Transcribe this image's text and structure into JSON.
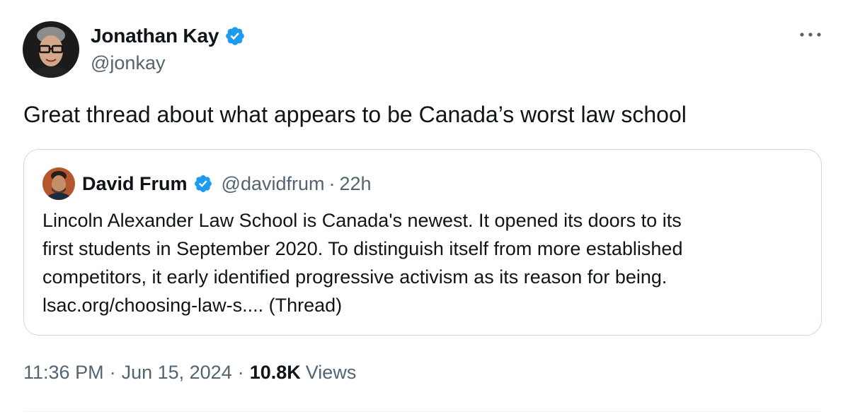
{
  "author": {
    "name": "Jonathan Kay",
    "handle": "@jonkay",
    "verified": true
  },
  "tweet": {
    "text": "Great thread about what appears to be Canada’s worst law school"
  },
  "quoted": {
    "name": "David Frum",
    "handle": "@davidfrum",
    "separator": "·",
    "time": "22h",
    "verified": true,
    "lines": [
      "Lincoln Alexander Law School is Canada's newest. It opened its doors to its",
      "first students in September 2020. To distinguish itself from more established",
      "competitors, it early identified progressive activism as its reason for being.",
      "lsac.org/choosing-law-s.... (Thread)"
    ]
  },
  "meta": {
    "time": "11:36 PM",
    "separator": "·",
    "date": "Jun 15, 2024",
    "views_count": "10.8K",
    "views_label": "Views"
  },
  "icons": {
    "more": "more-icon",
    "verified": "verified-badge-icon"
  },
  "colors": {
    "verified_blue": "#1d9bf0",
    "secondary_text": "#536471",
    "border": "#cfd9de"
  }
}
